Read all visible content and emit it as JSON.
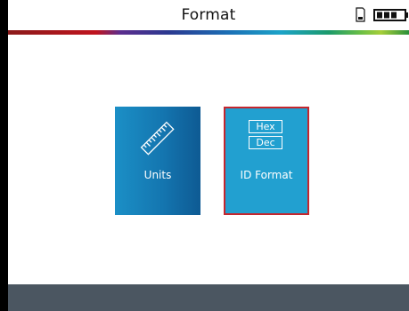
{
  "header": {
    "title": "Format",
    "icons": [
      "sd-card-icon",
      "battery-icon"
    ]
  },
  "colors": {
    "tile_blue": "#1b8fc6",
    "tile_selected": "#22a0d0",
    "selection_border": "#c4262e",
    "footer": "#4b5661"
  },
  "tiles": [
    {
      "label": "Units",
      "icon": "ruler-icon",
      "selected": false
    },
    {
      "label": "ID Format",
      "icon": "hex-dec-icon",
      "selected": true,
      "options": [
        "Hex",
        "Dec"
      ]
    }
  ]
}
